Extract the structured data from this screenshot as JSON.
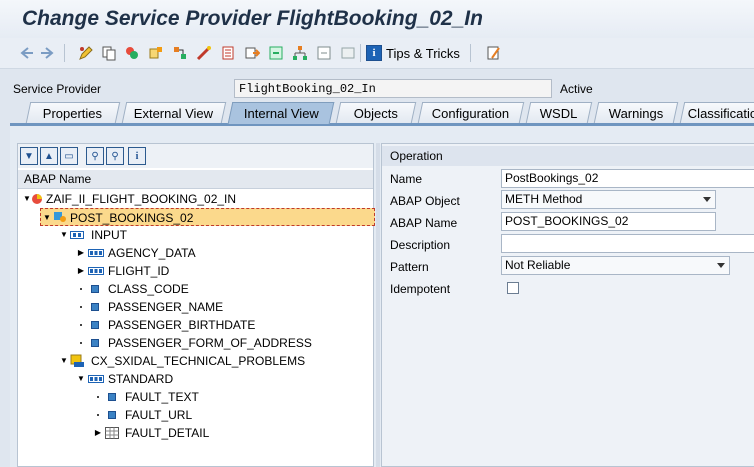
{
  "window": {
    "title": "Change Service Provider FlightBooking_02_In"
  },
  "toolbar": {
    "icons": [
      "back-icon",
      "forward-icon",
      "edit-icon",
      "copy-icon",
      "check-icon",
      "other-object-icon",
      "where-used-icon",
      "activate-icon",
      "display-object-list-icon",
      "navigation-window-icon",
      "import-icon",
      "hierarchy-icon",
      "export-icon",
      "layout-icon"
    ],
    "tips_label": "Tips & Tricks",
    "tips_icon": "info-icon",
    "settings_icon": "user-settings-icon"
  },
  "header": {
    "service_provider_label": "Service Provider",
    "service_provider_value": "FlightBooking_02_In",
    "status": "Active"
  },
  "tabs": [
    {
      "label": "Properties"
    },
    {
      "label": "External View"
    },
    {
      "label": "Internal View",
      "active": true
    },
    {
      "label": "Objects"
    },
    {
      "label": "Configuration"
    },
    {
      "label": "WSDL"
    },
    {
      "label": "Warnings"
    },
    {
      "label": "Classificatio"
    }
  ],
  "tree": {
    "toolbar_icons": [
      "expand-all-icon",
      "collapse-all-icon",
      "column-icon",
      "find-icon",
      "find-next-icon",
      "info-icon"
    ],
    "column_header": "ABAP Name",
    "rows": [
      {
        "label": "ZAIF_II_FLIGHT_BOOKING_02_IN"
      },
      {
        "label": "POST_BOOKINGS_02"
      },
      {
        "label": "INPUT"
      },
      {
        "label": "AGENCY_DATA"
      },
      {
        "label": "FLIGHT_ID"
      },
      {
        "label": "CLASS_CODE"
      },
      {
        "label": "PASSENGER_NAME"
      },
      {
        "label": "PASSENGER_BIRTHDATE"
      },
      {
        "label": "PASSENGER_FORM_OF_ADDRESS"
      },
      {
        "label": "CX_SXIDAL_TECHNICAL_PROBLEMS"
      },
      {
        "label": "STANDARD"
      },
      {
        "label": "FAULT_TEXT"
      },
      {
        "label": "FAULT_URL"
      },
      {
        "label": "FAULT_DETAIL"
      }
    ]
  },
  "operation": {
    "section_title": "Operation",
    "name_label": "Name",
    "name_value": "PostBookings_02",
    "abap_object_label": "ABAP Object",
    "abap_object_value": "METH Method",
    "abap_name_label": "ABAP Name",
    "abap_name_value": "POST_BOOKINGS_02",
    "description_label": "Description",
    "description_value": "",
    "pattern_label": "Pattern",
    "pattern_value": "Not Reliable",
    "idempotent_label": "Idempotent",
    "idempotent_checked": false
  },
  "colors": {
    "selection": "#fbd98c",
    "tab_active": "#a9c3df",
    "accent": "#1d63b5"
  }
}
